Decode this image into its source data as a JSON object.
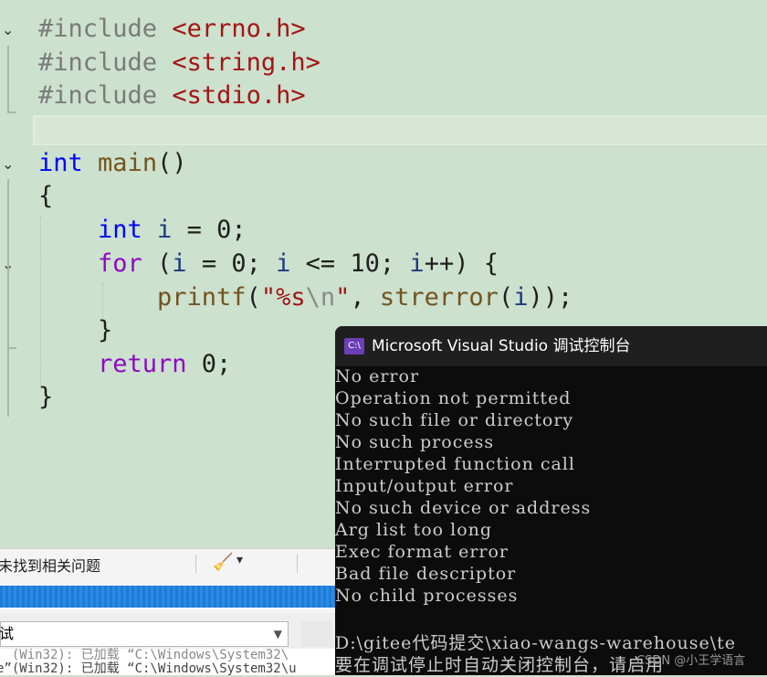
{
  "editor": {
    "lines": {
      "inc1_kw": "#include",
      "inc1_hdr": "<errno.h>",
      "inc2_kw": "#include",
      "inc2_hdr": "<string.h>",
      "inc3_kw": "#include",
      "inc3_hdr": "<stdio.h>",
      "main_type": "int",
      "main_name": "main",
      "main_parens": "()",
      "open_brace": "{",
      "decl_type": "int",
      "decl_var": "i",
      "decl_rest": " = 0;",
      "for_kw": "for",
      "for_open": " (",
      "for_i1": "i",
      "for_mid1": " = 0; ",
      "for_i2": "i",
      "for_mid2": " <= 10; ",
      "for_i3": "i",
      "for_end": "++) {",
      "printf_fn": "printf",
      "printf_open": "(",
      "printf_str1": "\"%s",
      "printf_esc": "\\n",
      "printf_str2": "\"",
      "printf_comma": ", ",
      "strerror_fn": "strerror",
      "strerror_open": "(",
      "strerror_arg": "i",
      "printf_close": "));",
      "close_for": "}",
      "return_kw": "return",
      "return_rest": " 0;",
      "close_main": "}"
    }
  },
  "error_list": {
    "status": "未找到相关问题"
  },
  "output": {
    "source": "试",
    "line1": "e”(Win32): 已加载 “C:\\Windows\\System32\\u",
    "line0": "  (Win32): 已加载 “C:\\Windows\\System32\\"
  },
  "console": {
    "title": "Microsoft Visual Studio 调试控制台",
    "icon": "C:\\",
    "lines": [
      "No error",
      "Operation not permitted",
      "No such file or directory",
      "No such process",
      "Interrupted function call",
      "Input/output error",
      "No such device or address",
      "Arg list too long",
      "Exec format error",
      "Bad file descriptor",
      "No child processes",
      "",
      "D:\\gitee代码提交\\xiao-wangs-warehouse\\te",
      "要在调试停止时自动关闭控制台，请启用"
    ]
  },
  "watermark": "CSDN @小王学语言"
}
